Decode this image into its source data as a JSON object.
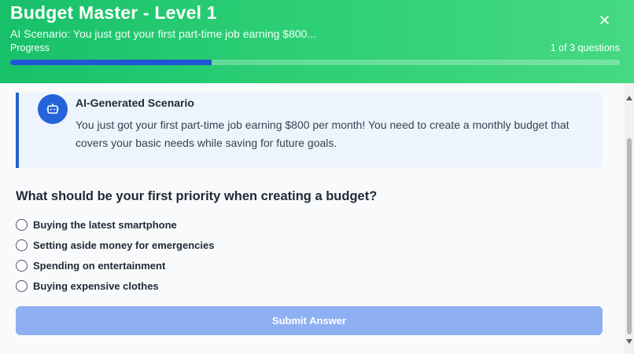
{
  "header": {
    "title": "Budget Master - Level 1",
    "subtitle": "AI Scenario: You just got your first part-time job earning $800...",
    "progress_label": "Progress",
    "progress_count": "1 of 3 questions",
    "progress_fraction": 0.33,
    "close_icon": "close-icon",
    "gradient_start": "#18c06a",
    "gradient_end": "#45d982",
    "progress_color": "#1f56d6"
  },
  "scenario": {
    "icon": "robot-icon",
    "title": "AI-Generated Scenario",
    "text": "You just got your first part-time job earning $800 per month! You need to create a monthly budget that covers your basic needs while saving for future goals.",
    "accent": "#2563c9"
  },
  "question": {
    "text": "What should be your first priority when creating a budget?",
    "options": [
      "Buying the latest smartphone",
      "Setting aside money for emergencies",
      "Spending on entertainment",
      "Buying expensive clothes"
    ]
  },
  "submit": {
    "label": "Submit Answer",
    "color": "#8eb0f3"
  }
}
